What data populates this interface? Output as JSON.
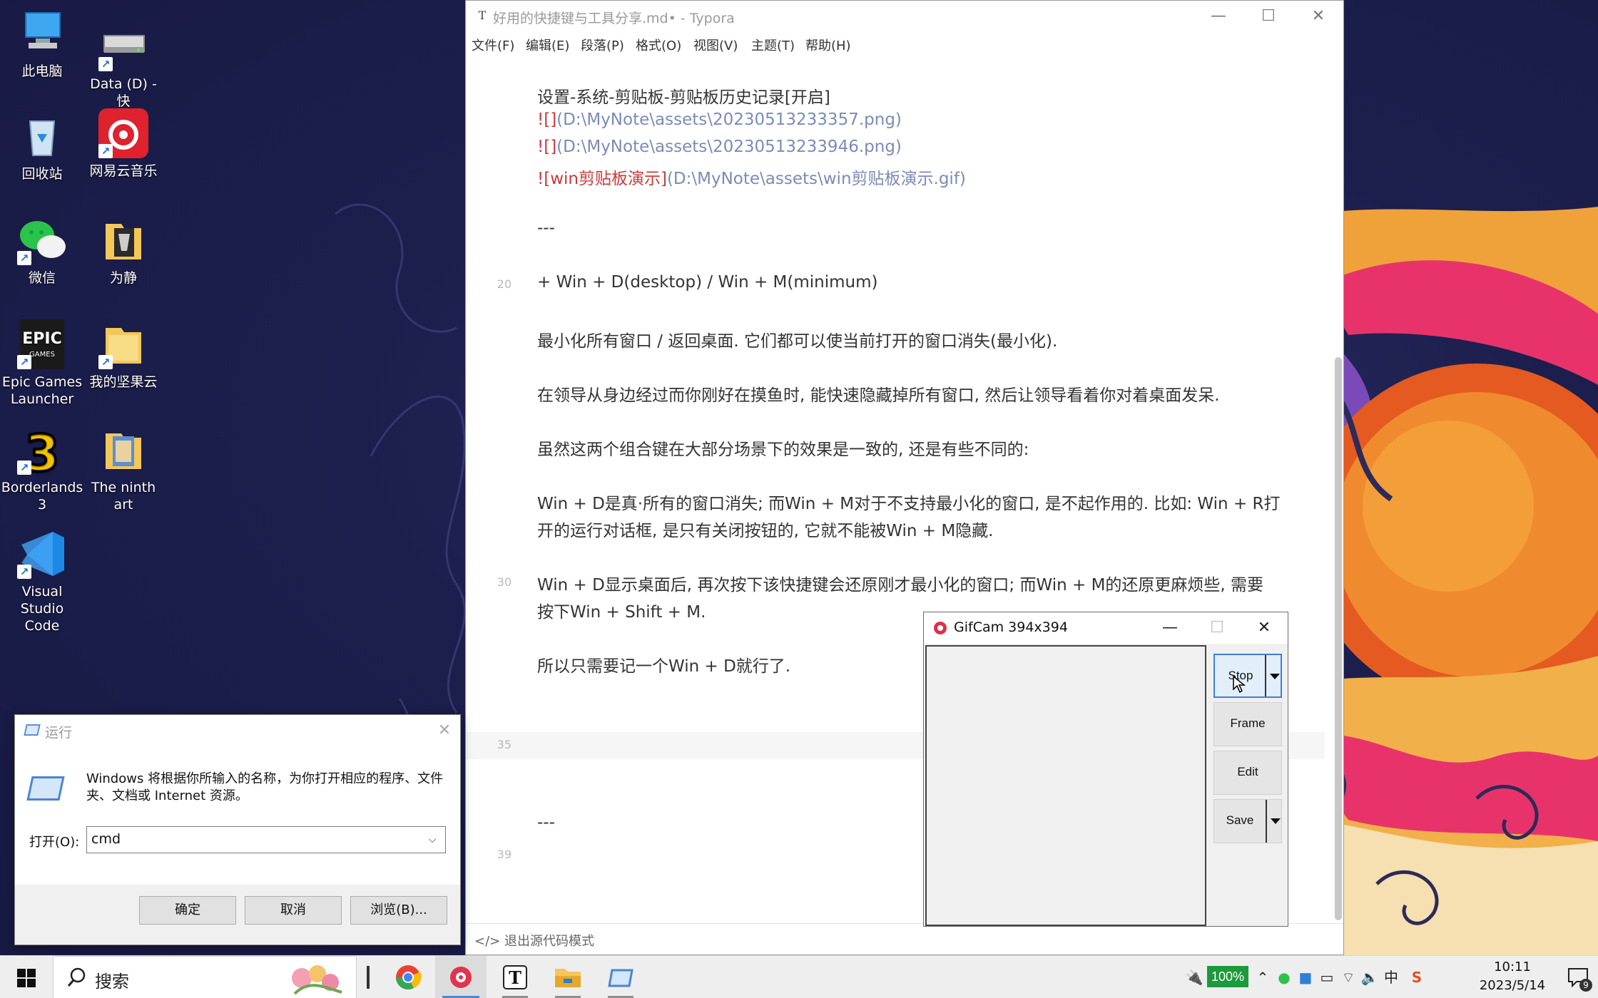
{
  "desktop": {
    "icons": [
      {
        "label": "此电脑"
      },
      {
        "label": "Data (D) - 快\n捷方式"
      },
      {
        "label": "回收站"
      },
      {
        "label": "网易云音乐"
      },
      {
        "label": "微信"
      },
      {
        "label": "为静"
      },
      {
        "label": "Epic Games\nLauncher"
      },
      {
        "label": "我的坚果云"
      },
      {
        "label": "Borderlands\n3"
      },
      {
        "label": "The ninth art"
      },
      {
        "label": "Visual Studio\nCode"
      }
    ]
  },
  "typora": {
    "title": "好用的快捷键与工具分享.md• - Typora",
    "menu": [
      "文件(F)",
      "编辑(E)",
      "段落(P)",
      "格式(O)",
      "视图(V)",
      "主题(T)",
      "帮助(H)"
    ],
    "lines": {
      "l1": "设置-系统-剪贴板-剪贴板历史记录[开启]",
      "img1_bang": "![]",
      "img1_path": "(D:\\MyNote\\assets\\20230513233357.png)",
      "img2_bang": "![]",
      "img2_path": "(D:\\MyNote\\assets\\20230513233946.png)",
      "img3_bang": "![win剪贴板演示]",
      "img3_path": "(D:\\MyNote\\assets\\win剪贴板演示.gif)",
      "hr1": "---",
      "bullet": "+  Win + D(desktop) / Win + M(minimum)",
      "p1": "最小化所有窗口 / 返回桌面. 它们都可以使当前打开的窗口消失(最小化).",
      "p2": "在领导从身边经过而你刚好在摸鱼时, 能快速隐藏掉所有窗口, 然后让领导看着你对着桌面发呆.",
      "p3": "虽然这两个组合键在大部分场景下的效果是一致的, 还是有些不同的:",
      "p4a": "Win + D是真·所有的窗口消失; 而Win + M对于不支持最小化的窗口, 是不起作用的. 比如: Win + R打",
      "p4b": "开的运行对话框, 是只有关闭按钮的, 它就不能被Win + M隐藏.",
      "p5a": "Win + D显示桌面后, 再次按下该快捷键会还原刚才最小化的窗口; 而Win + M的还原更麻烦些, 需要",
      "p5b": "按下Win + Shift + M.",
      "p6": "所以只需要记一个Win + D就行了.",
      "hr2": "---"
    },
    "line_numbers": {
      "n20": "20",
      "n30": "30",
      "n35": "35",
      "n39": "39"
    },
    "status": "</> 退出源代码模式"
  },
  "gifcam": {
    "title": "GifCam 394x394",
    "buttons": {
      "stop": "Stop",
      "frame": "Frame",
      "edit": "Edit",
      "save": "Save"
    }
  },
  "run_dialog": {
    "title": "运行",
    "description": "Windows 将根据你所输入的名称，为你打开相应的程序、文件夹、文档或 Internet 资源。",
    "open_label": "打开(O):",
    "input_value": "cmd",
    "ok": "确定",
    "cancel": "取消",
    "browse": "浏览(B)..."
  },
  "taskbar": {
    "search_text": "搜索",
    "battery": "100%",
    "ime": "中",
    "time": "10:11",
    "date": "2023/5/14",
    "notifications": "9"
  },
  "colors": {
    "accent": "#3c7fd8",
    "markdown_red": "#c83a3a",
    "markdown_path": "#7b8bb8",
    "battery": "#1c9a3c"
  }
}
